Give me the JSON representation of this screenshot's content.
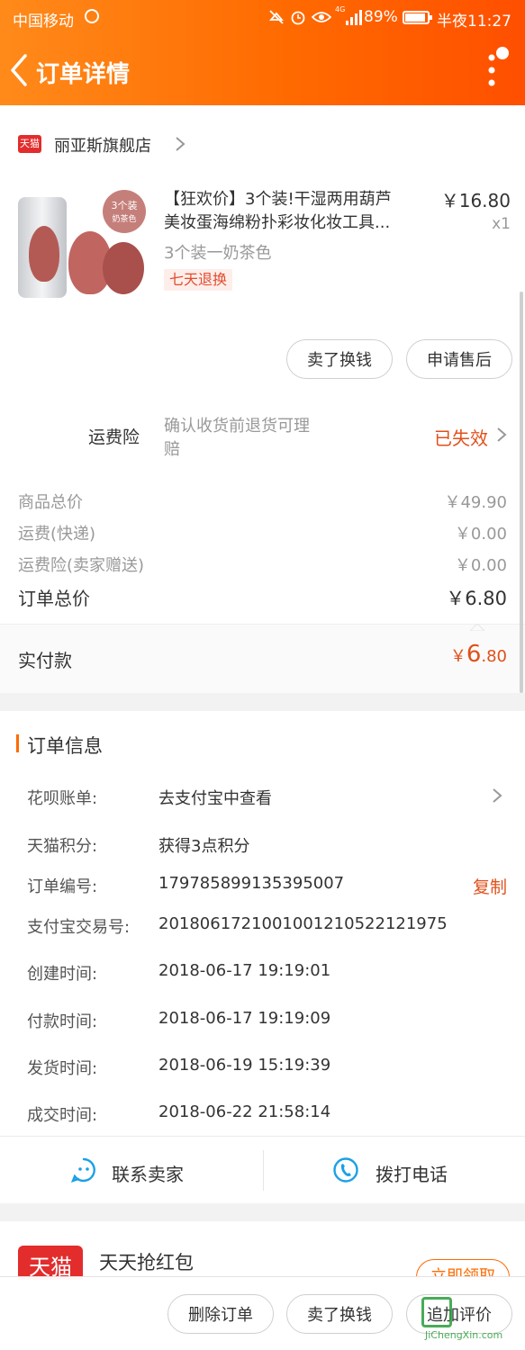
{
  "status_bar": {
    "carrier": "中国移动",
    "signal_tag": "4G",
    "battery_pct": "89%",
    "time": "半夜11:27"
  },
  "header": {
    "title": "订单详情",
    "back_icon": "chevron-left-icon",
    "more_icon": "more-vertical-icon"
  },
  "shop": {
    "badge": "天猫",
    "name": "丽亚斯旗舰店"
  },
  "product": {
    "title_line1": "【狂欢价】3个装!干湿两用葫芦",
    "title_line2": "美妆蛋海绵粉扑彩妆化妆工具...",
    "sku": "3个装一奶茶色",
    "tag": "七天退换",
    "price": "￥16.80",
    "qty": "x1",
    "image_badge_1": "3个装",
    "image_badge_2": "奶茶色"
  },
  "item_actions": {
    "resell": "卖了换钱",
    "after_sale": "申请售后"
  },
  "insurance": {
    "label": "运费险",
    "desc_line1": "确认收货前退货可理",
    "desc_line2": "赔",
    "status": "已失效"
  },
  "summary": {
    "goods_total_label": "商品总价",
    "goods_total": "￥49.90",
    "shipping_label": "运费(快递)",
    "shipping": "￥0.00",
    "insurance_label": "运费险(卖家赠送)",
    "insurance": "￥0.00",
    "order_total_label": "订单总价",
    "order_total": "￥6.80",
    "paid_label": "实付款",
    "paid_currency": "￥",
    "paid_int": "6",
    "paid_dec": ".80"
  },
  "order_info": {
    "section_title": "订单信息",
    "rows": [
      {
        "label": "花呗账单:",
        "value": "去支付宝中查看"
      },
      {
        "label": "天猫积分:",
        "value": "获得3点积分"
      },
      {
        "label": "订单编号:",
        "value": "179785899135395007"
      },
      {
        "label": "支付宝交易号:",
        "value": "2018061721001001210522121975"
      },
      {
        "label": "创建时间:",
        "value": "2018-06-17 19:19:01"
      },
      {
        "label": "付款时间:",
        "value": "2018-06-17 19:19:09"
      },
      {
        "label": "发货时间:",
        "value": "2018-06-19 15:19:39"
      },
      {
        "label": "成交时间:",
        "value": "2018-06-22 21:58:14"
      }
    ],
    "copy": "复制"
  },
  "contact": {
    "seller": "联系卖家",
    "call": "拨打电话"
  },
  "promo": {
    "logo": "天猫",
    "title": "天天抢红包",
    "button": "立即领取"
  },
  "bottom_bar": {
    "delete": "删除订单",
    "resell": "卖了换钱",
    "review": "追加评价"
  },
  "watermark": "JiChengXin.com",
  "colors": {
    "accent": "#ff6a00",
    "price_red": "#e0501b",
    "tag_red": "#e34b2f",
    "tmall_red": "#e32c2c",
    "icon_blue": "#1aa0e6"
  }
}
